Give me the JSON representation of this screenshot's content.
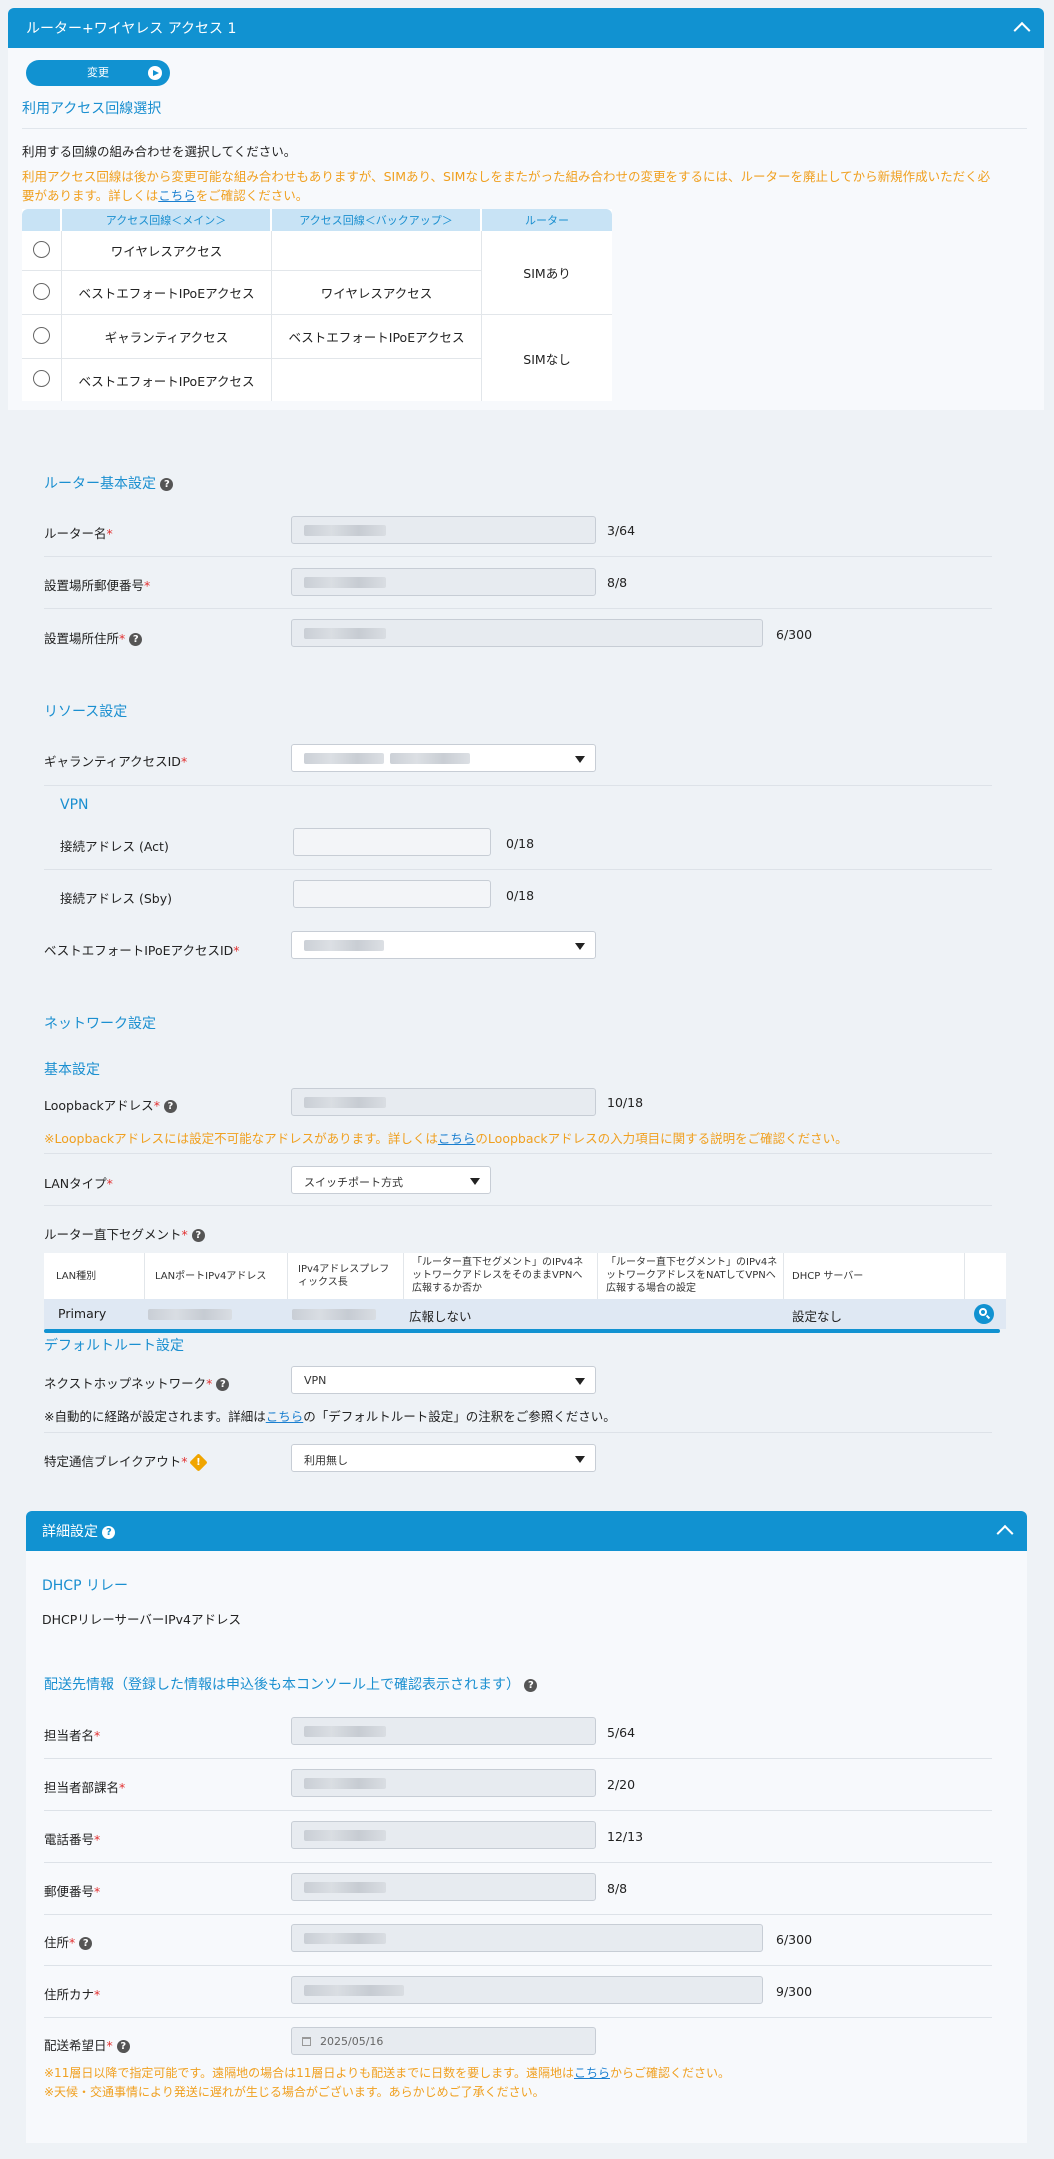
{
  "router_panel": {
    "title": "ルーター+ワイヤレス アクセス 1",
    "change_button": "変更"
  },
  "access": {
    "section_title": "利用アクセス回線選択",
    "instruction": "利用する回線の組み合わせを選択してください。",
    "note_line1": "利用アクセス回線は後から変更可能な組み合わせもありますが、SIMあり、SIMなしをまたがった組み合わせの変更をするには、ルーターを廃止してから新規作成いただく必",
    "note_line2_pre": "要があります。詳しくは",
    "note_link": "こちら",
    "note_line2_post": "をご確認ください。",
    "headers": [
      "アクセス回線＜メイン＞",
      "アクセス回線＜バックアップ＞",
      "ルーター"
    ],
    "rows": [
      {
        "main": "ワイヤレスアクセス",
        "backup": ""
      },
      {
        "main": "ベストエフォートIPoEアクセス",
        "backup": "ワイヤレスアクセス"
      },
      {
        "main": "ギャランティアクセス",
        "backup": "ベストエフォートIPoEアクセス"
      },
      {
        "main": "ベストエフォートIPoEアクセス",
        "backup": ""
      }
    ],
    "router_groups": [
      "SIMあり",
      "SIMなし"
    ]
  },
  "basic": {
    "section_title": "ルーター基本設定",
    "router_name_label": "ルーター名",
    "router_name_count": "3/64",
    "postal_label": "設置場所郵便番号",
    "postal_count": "8/8",
    "address_label": "設置場所住所",
    "address_count": "6/300"
  },
  "resource": {
    "section_title": "リソース設定",
    "guarantee_label": "ギャランティアクセスID",
    "vpn_title": "VPN",
    "act_label": "接続アドレス (Act)",
    "act_count": "0/18",
    "sby_label": "接続アドレス (Sby)",
    "sby_count": "0/18",
    "besteffort_label": "ベストエフォートIPoEアクセスID"
  },
  "network": {
    "section_title": "ネットワーク設定",
    "basic_title": "基本設定",
    "loopback_label": "Loopbackアドレス",
    "loopback_count": "10/18",
    "loopback_note_pre": "※Loopbackアドレスには設定不可能なアドレスがあります。詳しくは",
    "loopback_note_link": "こちら",
    "loopback_note_post": "のLoopbackアドレスの入力項目に関する説明をご確認ください。",
    "lan_type_label": "LANタイプ",
    "lan_type_value": "スイッチポート方式",
    "segment_label": "ルーター直下セグメント",
    "seg_headers": {
      "h1": "LAN種別",
      "h2": "LANポートIPv4アドレス",
      "h3a": "IPv4アドレスプレフ",
      "h3b": "ィックス長",
      "h4a": "「ルーター直下セグメント」のIPv4ネ",
      "h4b": "ットワークアドレスをそのままVPNへ",
      "h4c": "広報するか否か",
      "h5a": "「ルーター直下セグメント」のIPv4ネ",
      "h5b": "ットワークアドレスをNATしてVPNへ",
      "h5c": "広報する場合の設定",
      "h6": "DHCP サーバー"
    },
    "seg_row": {
      "lan": "Primary",
      "advertise": "広報しない",
      "dhcp": "設定なし"
    },
    "default_route_title": "デフォルトルート設定",
    "nexthop_label": "ネクストホップネットワーク",
    "nexthop_value": "VPN",
    "route_note_pre": "※自動的に経路が設定されます。詳細は",
    "route_note_link": "こちら",
    "route_note_post": "の「デフォルトルート設定」の注釈をご参照ください。",
    "breakout_label": "特定通信ブレイクアウト",
    "breakout_value": "利用無し"
  },
  "detail": {
    "title": "詳細設定",
    "dhcp_title": "DHCP リレー",
    "dhcp_label": "DHCPリレーサーバーIPv4アドレス",
    "delivery_title": "配送先情報（登録した情報は申込後も本コンソール上で確認表示されます）",
    "person_label": "担当者名",
    "person_count": "5/64",
    "dept_label": "担当者部課名",
    "dept_count": "2/20",
    "phone_label": "電話番号",
    "phone_count": "12/13",
    "zip_label": "郵便番号",
    "zip_count": "8/8",
    "addr_label": "住所",
    "addr_count": "6/300",
    "kana_label": "住所カナ",
    "kana_count": "9/300",
    "date_label": "配送希望日",
    "date_value": "2025/05/16",
    "note1_pre": "※11層日以降で指定可能です。遠隔地の場合は11層日よりも配送までに日数を要します。遠隔地は",
    "note1_link": "こちら",
    "note1_post": "からご確認ください。",
    "note2": "※天候・交通事情により発送に遅れが生じる場合がございます。あらかじめご了承ください。"
  },
  "colors": {
    "primary": "#1192d1",
    "accent_text": "#1a8fd0",
    "warning": "#f0a020",
    "required": "#e23030"
  }
}
